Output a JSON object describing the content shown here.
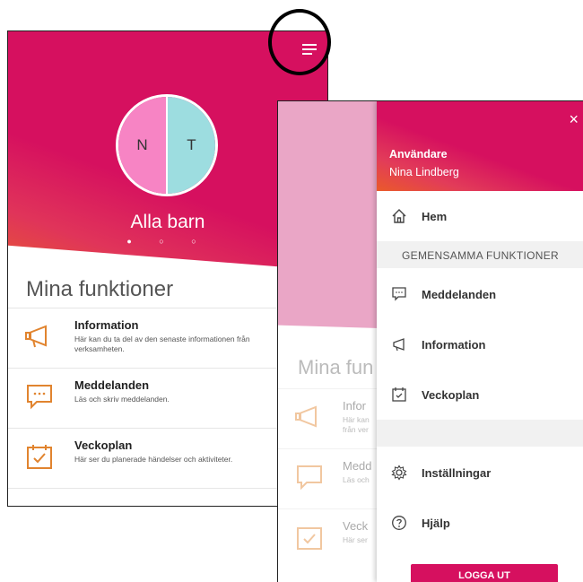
{
  "screen1": {
    "child_initials": [
      "N",
      "T"
    ],
    "child_name": "Alla barn",
    "section_title": "Mina funktioner",
    "items": [
      {
        "title": "Information",
        "desc": "Här kan du ta del av den senaste informationen från verksamheten."
      },
      {
        "title": "Meddelanden",
        "desc": "Läs och skriv meddelanden."
      },
      {
        "title": "Veckoplan",
        "desc": "Här ser du planerade händelser och aktiviteter."
      }
    ]
  },
  "screen2": {
    "section_title_partial": "Mina fun",
    "items_partial": [
      {
        "title": "Infor",
        "desc1": "Här kan",
        "desc2": "från ver"
      },
      {
        "title": "Medd",
        "desc1": "Läs och"
      },
      {
        "title": "Veck",
        "desc1": "Här ser"
      }
    ]
  },
  "drawer": {
    "close": "×",
    "user_label": "Användare",
    "user_name": "Nina Lindberg",
    "home": "Hem",
    "section": "GEMENSAMMA FUNKTIONER",
    "items": [
      "Meddelanden",
      "Information",
      "Veckoplan"
    ],
    "settings": "Inställningar",
    "help": "Hjälp",
    "logout": "LOGGA UT"
  },
  "colors": {
    "brand": "#d6105f",
    "accent": "#ea6a1e",
    "icon": "#e1842f"
  }
}
